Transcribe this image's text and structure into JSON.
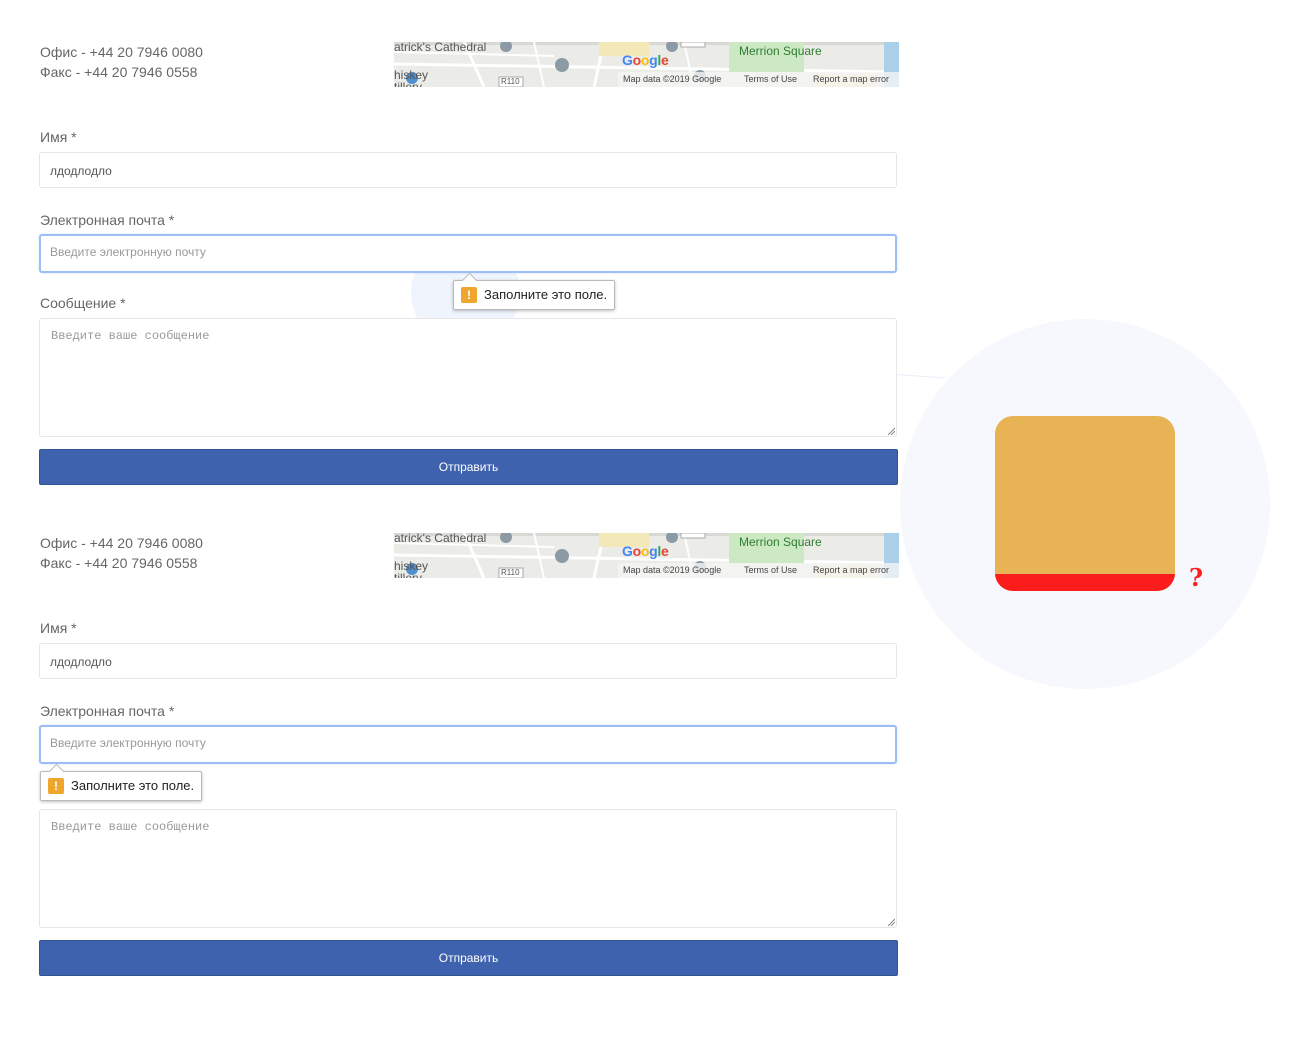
{
  "contacts": {
    "office": "Офис - +44 20 7946 0080",
    "fax": "Факс - +44 20 7946 0558"
  },
  "map": {
    "place_cathedral": "atrick's Cathedral",
    "place_distillery_1": "hiskey",
    "place_distillery_2": "tillery",
    "road_r110": "R110",
    "place_merrion": "Merrion Square",
    "google_letters": [
      "G",
      "o",
      "o",
      "g",
      "l",
      "e"
    ],
    "map_data": "Map data ©2019 Google",
    "terms": "Terms of Use",
    "report": "Report a map error"
  },
  "form": {
    "name_label": "Имя *",
    "name_value": "лдодлодло",
    "email_label": "Электронная почта *",
    "email_placeholder": "Введите электронную почту",
    "message_label": "Сообщение *",
    "message_placeholder": "Введите ваше сообщение",
    "submit_label": "Отправить"
  },
  "validation": {
    "icon_glyph": "!",
    "message": "Заполните это поле."
  },
  "callout": {
    "glyph": "?",
    "icon_color": "#e8b354",
    "stripe_color": "#fb1c1c",
    "glyph_color": "#ff1d1d"
  },
  "colors": {
    "button": "#3e62ad",
    "focus_border": "#9ebcf5",
    "warning": "#efa62c"
  }
}
